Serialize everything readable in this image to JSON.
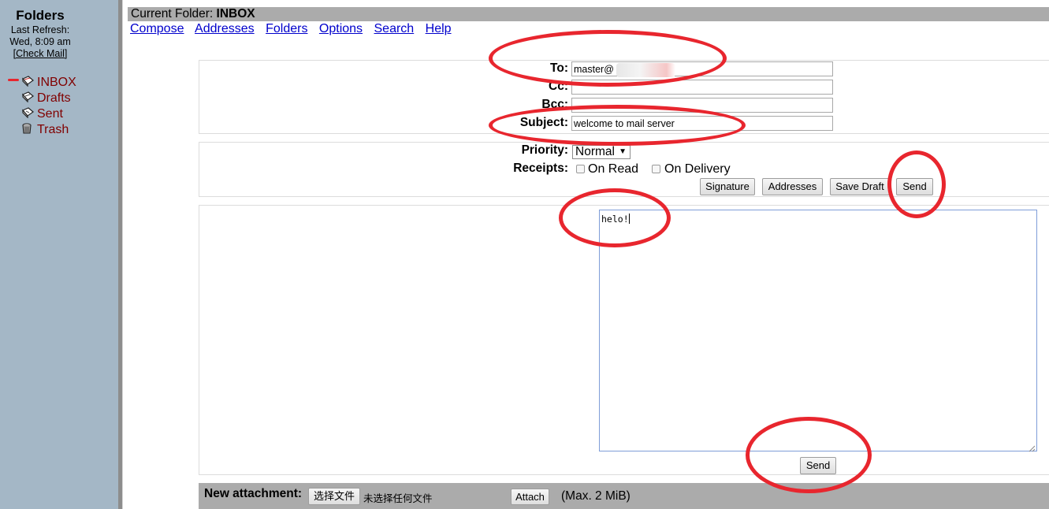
{
  "sidebar": {
    "title": "Folders",
    "refresh_label": "Last Refresh:",
    "refresh_time": "Wed, 8:09 am",
    "check_mail": "[Check Mail]",
    "folders": [
      {
        "label": "INBOX",
        "icon": "inbox-folder-icon"
      },
      {
        "label": "Drafts",
        "icon": "drafts-folder-icon"
      },
      {
        "label": "Sent",
        "icon": "sent-folder-icon"
      },
      {
        "label": "Trash",
        "icon": "trash-folder-icon"
      }
    ]
  },
  "header": {
    "current_folder_label": "Current Folder:",
    "current_folder": "INBOX",
    "nav": [
      "Compose",
      "Addresses",
      "Folders",
      "Options",
      "Search",
      "Help"
    ]
  },
  "compose": {
    "to_label": "To:",
    "to_value": "master@",
    "cc_label": "Cc:",
    "cc_value": "",
    "bcc_label": "Bcc:",
    "bcc_value": "",
    "subject_label": "Subject:",
    "subject_value": "welcome to mail server",
    "priority_label": "Priority:",
    "priority_value": "Normal",
    "receipts_label": "Receipts:",
    "on_read": "On Read",
    "on_delivery": "On Delivery",
    "buttons": {
      "signature": "Signature",
      "addresses": "Addresses",
      "save_draft": "Save Draft",
      "send": "Send"
    },
    "body": "helo!",
    "bottom_send": "Send"
  },
  "attachment": {
    "label": "New attachment:",
    "choose_file": "选择文件",
    "no_file": "未选择任何文件",
    "attach": "Attach",
    "max_size": "(Max. 2 MiB)"
  },
  "colors": {
    "sidebar_bg": "#a4b7c6",
    "folder_link": "#800000",
    "nav_link": "#0000cc",
    "annotation": "#e8262e"
  }
}
